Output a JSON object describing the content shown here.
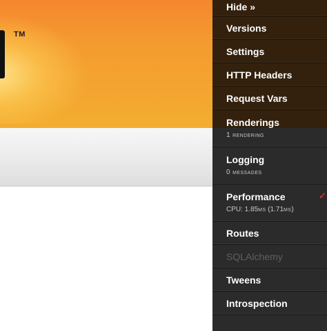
{
  "header": {
    "trademark": "TM"
  },
  "toolbar": {
    "hide_label": "Hide »",
    "panels": [
      {
        "title": "Versions"
      },
      {
        "title": "Settings"
      },
      {
        "title": "HTTP Headers"
      },
      {
        "title": "Request Vars"
      },
      {
        "title": "Renderings",
        "subtitle": "1 rendering"
      },
      {
        "title": "Logging",
        "subtitle": "0 messages"
      },
      {
        "title": "Performance",
        "subtitle_prefix": "CPU: 1.85",
        "subtitle_unit1": "ms",
        "subtitle_mid": " (1.71",
        "subtitle_unit2": "ms",
        "subtitle_suffix": ")",
        "checked": true
      },
      {
        "title": "Routes"
      },
      {
        "title": "SQLAlchemy",
        "disabled": true
      },
      {
        "title": "Tweens"
      },
      {
        "title": "Introspection"
      }
    ],
    "check_glyph": "✓"
  },
  "colors": {
    "banner_top": "#f5872f",
    "banner_bottom": "#f3ad30",
    "toolbar_bg": "#2b2b2b",
    "check": "#d9302c",
    "disabled_text": "#5f5f5f"
  }
}
